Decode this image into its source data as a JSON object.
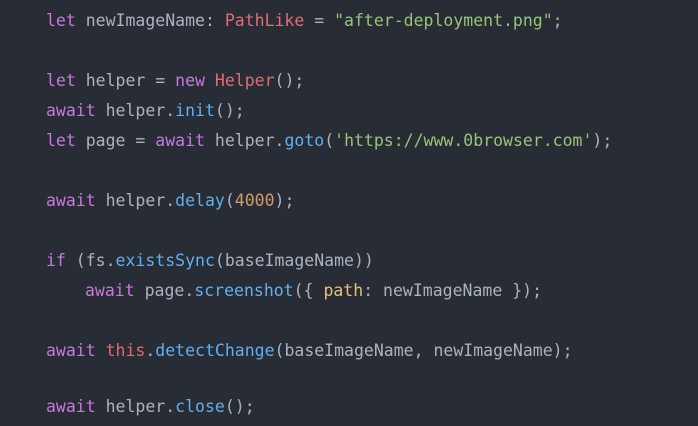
{
  "colors": {
    "background": "#282c34",
    "keyword": "#c678dd",
    "function": "#61afef",
    "type": "#e06c75",
    "string": "#98c379",
    "number": "#d19a66",
    "property": "#e5c07b",
    "plain": "#abb2bf"
  },
  "code": {
    "l1": {
      "kw": "let",
      "p1": " newImageName: ",
      "type": "PathLike",
      "p2": " = ",
      "str": "\"after-deployment.png\"",
      "p3": ";"
    },
    "l3": {
      "kw1": "let",
      "p1": " helper = ",
      "kw2": "new",
      "p2": " ",
      "type": "Helper",
      "p3": "();"
    },
    "l4": {
      "kw": "await",
      "p1": " helper.",
      "fn": "init",
      "p2": "();"
    },
    "l5": {
      "kw1": "let",
      "p1": " page = ",
      "kw2": "await",
      "p2": " helper.",
      "fn": "goto",
      "p3": "(",
      "str": "'https://www.0browser.com'",
      "p4": ");"
    },
    "l7": {
      "kw": "await",
      "p1": " helper.",
      "fn": "delay",
      "p2": "(",
      "num": "4000",
      "p3": ");"
    },
    "l9": {
      "kw": "if",
      "p1": " (fs.",
      "fn": "existsSync",
      "p2": "(baseImageName))"
    },
    "l10": {
      "kw": "await",
      "p1": " page.",
      "fn": "screenshot",
      "p2": "({ ",
      "prop": "path",
      "p3": ": newImageName });"
    },
    "l12": {
      "kw1": "await",
      "p1": " ",
      "kw2": "this",
      "p2": ".",
      "fn": "detectChange",
      "p3": "(baseImageName, newImageName);"
    },
    "l14": {
      "kw": "await",
      "p1": " helper.",
      "fn": "close",
      "p2": "();"
    }
  }
}
